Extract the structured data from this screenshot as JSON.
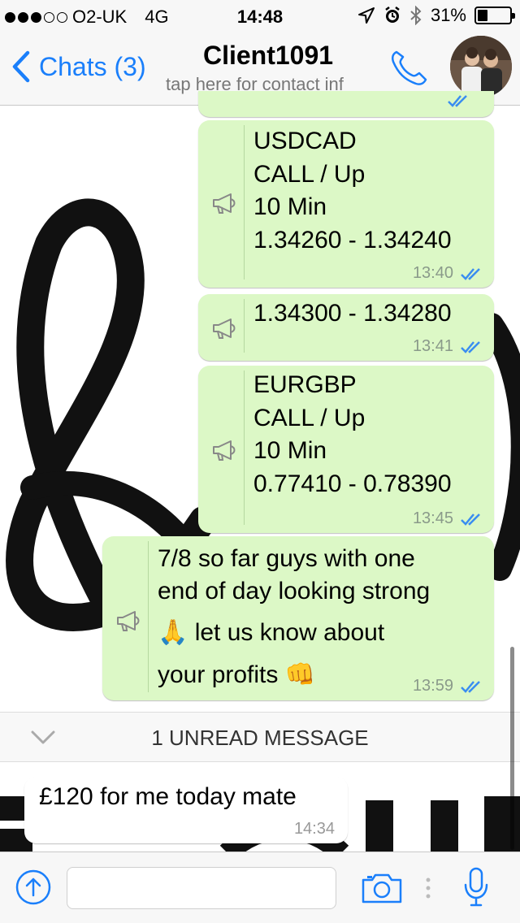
{
  "status_bar": {
    "carrier": "O2-UK",
    "network": "4G",
    "time": "14:48",
    "battery": "31%",
    "battery_level": 0.31,
    "signal_bars": 3
  },
  "nav": {
    "back_label": "Chats (3)",
    "title": "Client1091",
    "subtitle": "tap here for contact inf"
  },
  "messages": [
    {
      "lines": [
        "USDCAD",
        "CALL / Up",
        "10 Min",
        "1.34260 - 1.34240"
      ],
      "time": "13:40"
    },
    {
      "lines": [
        "1.34300 - 1.34280"
      ],
      "time": "13:41"
    },
    {
      "lines": [
        "EURGBP",
        "CALL / Up",
        "10 Min",
        "0.77410 - 0.78390"
      ],
      "time": "13:45"
    },
    {
      "lines": [
        "7/8 so far guys with one",
        "end of day looking strong",
        "🙏 let us know about",
        "your profits 👊"
      ],
      "time": "13:59"
    }
  ],
  "unread": {
    "label": "1 UNREAD MESSAGE"
  },
  "incoming": {
    "text": "£120 for me today mate",
    "time": "14:34"
  },
  "input": {
    "placeholder": ""
  },
  "colors": {
    "accent": "#1a7ffb",
    "outgoing_bubble": "#dcf8c6",
    "incoming_bubble": "#ffffff",
    "read_ticks": "#3a8df0"
  }
}
